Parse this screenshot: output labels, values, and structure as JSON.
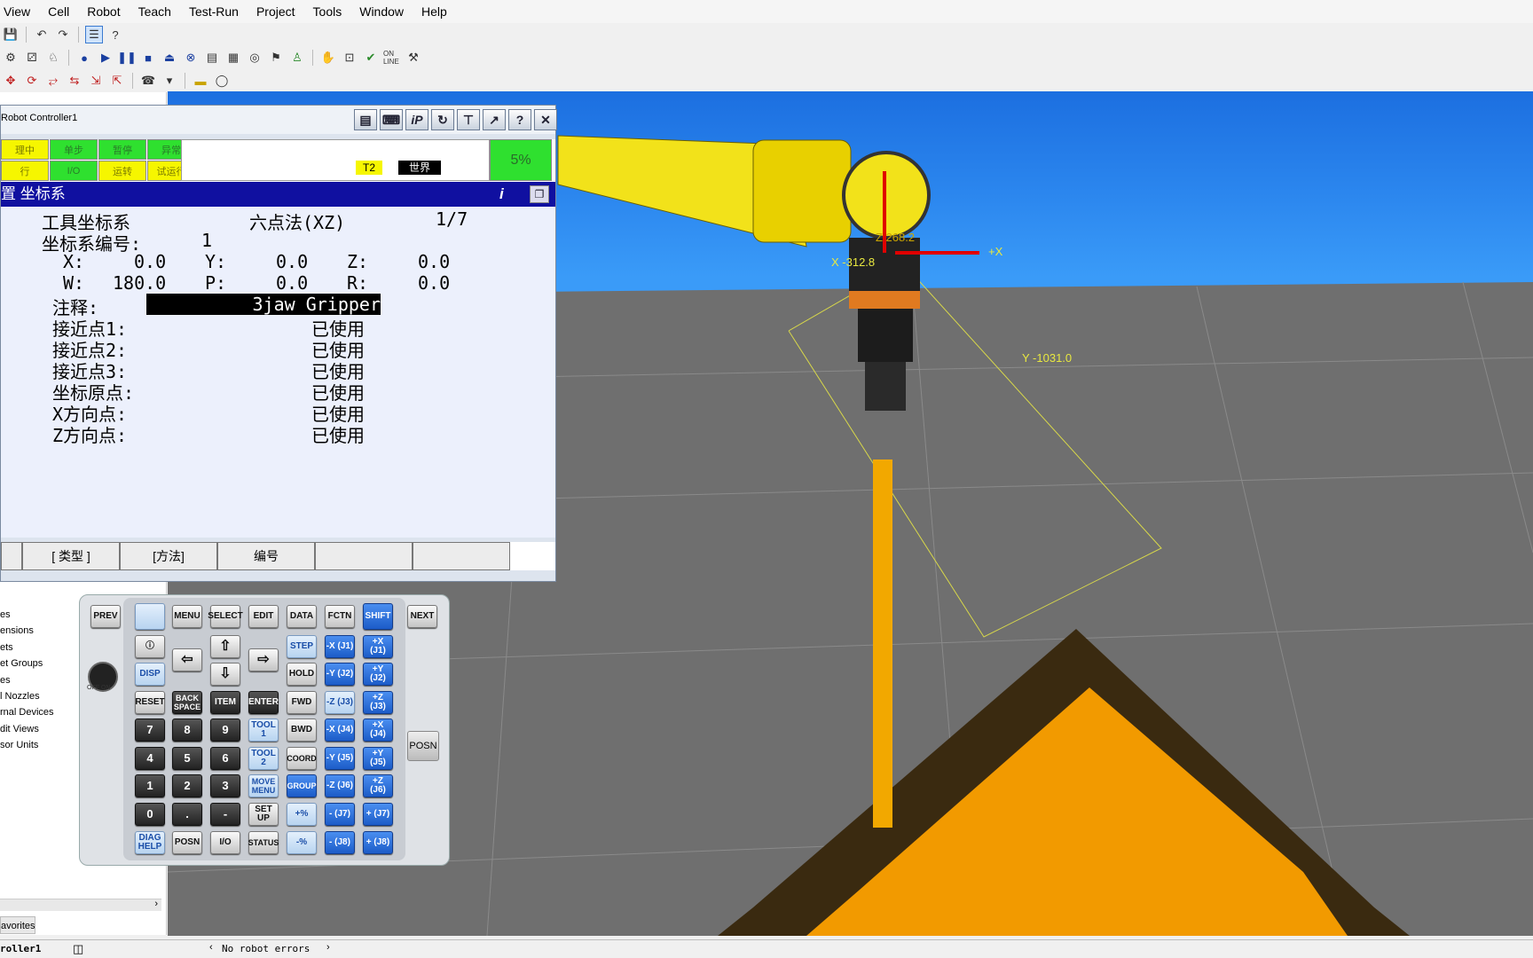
{
  "menu": [
    "View",
    "Cell",
    "Robot",
    "Teach",
    "Test-Run",
    "Project",
    "Tools",
    "Window",
    "Help"
  ],
  "sidebar": {
    "tree_items": [
      "es",
      "ensions",
      "ets",
      "et Groups",
      "es",
      "l Nozzles",
      "rnal Devices",
      "dit Views",
      "sor Units"
    ],
    "favorites_tab": "avorites"
  },
  "viewport": {
    "label_x": "X -312.8",
    "label_plus_x": "+X",
    "label_y": "Y -1031.0",
    "label_z": "Z 268.2"
  },
  "pendant": {
    "title": "Robot Controller1",
    "toolbar_icons": [
      "clipboard-icon",
      "keyboard-icon",
      "ip-icon",
      "refresh-icon",
      "pin-icon",
      "export-icon",
      "help-icon",
      "close-icon"
    ],
    "leds": [
      {
        "label": "理中",
        "color": "yellow"
      },
      {
        "label": "单步",
        "color": "green"
      },
      {
        "label": "暂停",
        "color": "green"
      },
      {
        "label": "异常",
        "color": "green"
      },
      {
        "label": "行",
        "color": "yellow"
      },
      {
        "label": "I/O",
        "color": "green"
      },
      {
        "label": "运转",
        "color": "yellow"
      },
      {
        "label": "试运行",
        "color": "yellow"
      }
    ],
    "mode": "T2",
    "frame": "世界",
    "override": "5%",
    "header": "置 坐标系",
    "header_info": "i",
    "screen": {
      "line1_left": "工具坐标系",
      "line1_method": "六点法(XZ)",
      "line1_page": "1/7",
      "frame_no_label": "坐标系编号:",
      "frame_no": "1",
      "x_label": "X:",
      "x": "0.0",
      "y_label": "Y:",
      "y": "0.0",
      "z_label": "Z:",
      "z": "0.0",
      "w_label": "W:",
      "w": "180.0",
      "p_label": "P:",
      "p": "0.0",
      "r_label": "R:",
      "r": "0.0",
      "comment_label": "注释:",
      "comment": "3jaw Gripper",
      "points": [
        {
          "label": "接近点1:",
          "status": "已使用"
        },
        {
          "label": "接近点2:",
          "status": "已使用"
        },
        {
          "label": "接近点3:",
          "status": "已使用"
        },
        {
          "label": "坐标原点:",
          "status": "已使用"
        },
        {
          "label": "X方向点:",
          "status": "已使用"
        },
        {
          "label": "Z方向点:",
          "status": "已使用"
        }
      ]
    },
    "fkeys": [
      "",
      "[ 类型 ]",
      "[方法]",
      "编号",
      "",
      ""
    ]
  },
  "keypad": {
    "prev": "PREV",
    "next": "NEXT",
    "menu": "MENU",
    "select": "SELECT",
    "edit": "EDIT",
    "data": "DATA",
    "fctn": "FCTN",
    "shift": "SHIFT",
    "step": "STEP",
    "hold": "HOLD",
    "fwd": "FWD",
    "bwd": "BWD",
    "coord": "COORD",
    "group": "GROUP",
    "disp": "DISP",
    "reset": "RESET",
    "backspace": "BACK SPACE",
    "item": "ITEM",
    "enter": "ENTER",
    "tool1": "TOOL 1",
    "tool2": "TOOL 2",
    "move_menu": "MOVE MENU",
    "setup": "SET UP",
    "status": "STATUS",
    "diag_help": "DIAG HELP",
    "posn": "POSN",
    "io": "I/O",
    "posn_side": "POSN",
    "digits": [
      "7",
      "8",
      "9",
      "4",
      "5",
      "6",
      "1",
      "2",
      "3",
      "0",
      "."
    ],
    "minus": "-",
    "jog_minus": [
      "-X (J1)",
      "-Y (J2)",
      "-Z (J3)",
      "-X (J4)",
      "-Y (J5)",
      "-Z (J6)",
      "- (J7)",
      "- (J8)"
    ],
    "jog_plus": [
      "+X (J1)",
      "+Y (J2)",
      "+Z (J3)",
      "+X (J4)",
      "+Y (J5)",
      "+Z (J6)",
      "+ (J7)",
      "+ (J8)"
    ],
    "speed_up": "+%",
    "speed_down": "-%",
    "keyswitch_label": "OFF ON"
  },
  "statusbar": {
    "controller": "roller1",
    "errors": "No robot errors"
  },
  "colors": {
    "robot_yellow": "#f2e21a",
    "part_orange": "#f29a00",
    "sky_blue": "#2b86ee",
    "floor_gray": "#6f6f6f",
    "header_blue": "#1010a0",
    "led_green": "#2fe02f"
  }
}
